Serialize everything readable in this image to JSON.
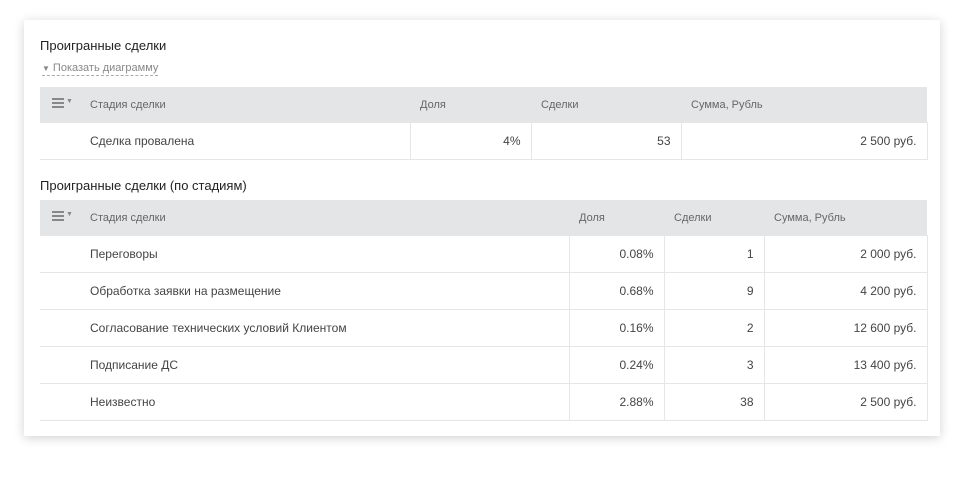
{
  "lost_deals": {
    "title": "Проигранные сделки",
    "toggle_label": "Показать диаграмму",
    "columns": [
      "Стадия сделки",
      "Доля",
      "Сделки",
      "Сумма, Рубль"
    ],
    "rows": [
      {
        "stage": "Сделка провалена",
        "share": "4%",
        "deals": "53",
        "sum": "2 500 руб."
      }
    ]
  },
  "lost_by_stage": {
    "title": "Проигранные сделки (по стадиям)",
    "columns": [
      "Стадия сделки",
      "Доля",
      "Сделки",
      "Сумма, Рубль"
    ],
    "rows": [
      {
        "stage": "Переговоры",
        "share": "0.08%",
        "deals": "1",
        "sum": "2 000 руб."
      },
      {
        "stage": "Обработка заявки на размещение",
        "share": "0.68%",
        "deals": "9",
        "sum": "4 200 руб."
      },
      {
        "stage": "Согласование технических условий Клиентом",
        "share": "0.16%",
        "deals": "2",
        "sum": "12 600 руб."
      },
      {
        "stage": "Подписание ДС",
        "share": "0.24%",
        "deals": "3",
        "sum": "13 400 руб."
      },
      {
        "stage": "Неизвестно",
        "share": "2.88%",
        "deals": "38",
        "sum": "2 500 руб."
      }
    ]
  },
  "colors": {
    "link": "#2b63a0",
    "header_bg": "#e4e5e6"
  }
}
